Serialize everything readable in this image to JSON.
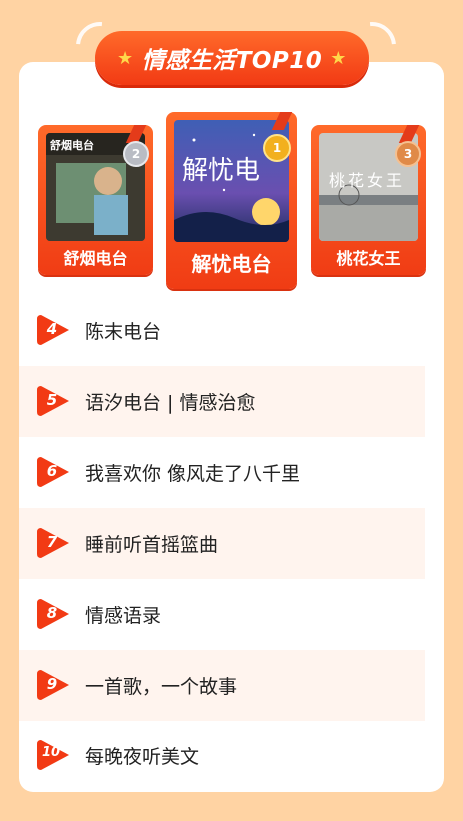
{
  "colors": {
    "background": "#ffd3a3",
    "accent": "#f23a14",
    "gold": "#ffd84a"
  },
  "banner": {
    "title": "情感生活TOP10",
    "star_icon": "star-icon"
  },
  "top3": [
    {
      "rank": "2",
      "name": "舒烟电台",
      "cover_text": "舒烟电台"
    },
    {
      "rank": "1",
      "name": "解忧电台",
      "cover_text": "解忧电"
    },
    {
      "rank": "3",
      "name": "桃花女王",
      "cover_text": "桃花女王"
    }
  ],
  "list": [
    {
      "rank": "4",
      "title": "陈末电台"
    },
    {
      "rank": "5",
      "title": "语汐电台 | 情感治愈"
    },
    {
      "rank": "6",
      "title": "我喜欢你 像风走了八千里"
    },
    {
      "rank": "7",
      "title": "睡前听首摇篮曲"
    },
    {
      "rank": "8",
      "title": "情感语录"
    },
    {
      "rank": "9",
      "title": "一首歌，一个故事"
    },
    {
      "rank": "10",
      "title": "每晚夜听美文"
    }
  ]
}
